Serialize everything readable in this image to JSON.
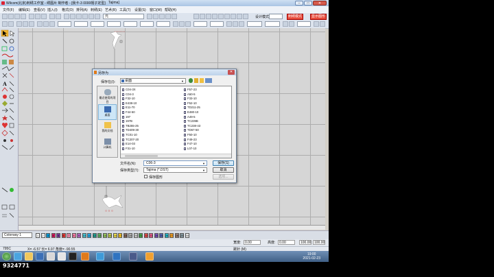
{
  "window": {
    "title": "Wilcom(北京)刺绣工作室 - 绣图片 制作者 - [我卡-3 0000帽子定型]",
    "tab": "Tajima]"
  },
  "menu": [
    "文件(F)",
    "编辑(E)",
    "查看(V)",
    "插入(I)",
    "格式(O)",
    "排列(A)",
    "刺绣(E)",
    "艺术(R)",
    "工具(T)",
    "设置(S)",
    "窗口(W)",
    "帮助(H)"
  ],
  "toolbar": {
    "zoom_value": "元",
    "design_mode_label": "设计模式:",
    "btn_a": "刺绣模式",
    "btn_b": "显示图形"
  },
  "dialog": {
    "title": "另存为",
    "look_in_label": "保存在(I):",
    "look_in_value": "桌面",
    "places": [
      "最近使用的项目",
      "桌面",
      "我的文档",
      "计算机"
    ],
    "files_col1": [
      "C04-3X",
      "C04-3",
      "F32-10",
      "E438-10",
      "E11-70",
      "F44-50",
      "197",
      "197B",
      "TB255-25",
      "TD409-30",
      "TC01-10",
      "TC207-20",
      "E14-03",
      "F31-10"
    ],
    "files_col2": [
      "F57-23",
      "A50-5",
      "F33-10",
      "F52-10",
      "TD211-25",
      "E480-10",
      "A49-5",
      "TC239B",
      "TC238-43",
      "TD67-50",
      "F50-10",
      "F49-23",
      "F47-10",
      "L07-10"
    ],
    "filename_label": "文件名(N):",
    "filename_value": "C06-3",
    "filetype_label": "保存类型(T):",
    "filetype_value": "Tajima (*.DST)",
    "save_btn": "保存(S)",
    "cancel_btn": "取消",
    "options_btn": "选项...",
    "checkbox_label": "保存图形"
  },
  "colorbar": {
    "colorway": "Colorway 1",
    "swatches": [
      {
        "n": "1",
        "c": "#ffffff"
      },
      {
        "n": "2",
        "c": "#ffffff"
      },
      {
        "n": "3",
        "c": "#00a0e0"
      },
      {
        "n": "4",
        "c": "#d81b60"
      },
      {
        "n": "5",
        "c": "#7b3fa0"
      },
      {
        "n": "6",
        "c": "#e53935"
      },
      {
        "n": "7",
        "c": "#f48fb1"
      },
      {
        "n": "8",
        "c": "#ff80ab"
      },
      {
        "n": "9",
        "c": "#ba68c8"
      },
      {
        "n": "10",
        "c": "#4dd0e1"
      },
      {
        "n": "11",
        "c": "#29b6f6"
      },
      {
        "n": "12",
        "c": "#26a69a"
      },
      {
        "n": "13",
        "c": "#66bb6a"
      },
      {
        "n": "14",
        "c": "#9ccc65"
      },
      {
        "n": "15",
        "c": "#d4e157"
      },
      {
        "n": "16",
        "c": "#ffee58"
      },
      {
        "n": "17",
        "c": "#ffca28"
      },
      {
        "n": "18",
        "c": "#8d6e63"
      },
      {
        "n": "19",
        "c": "#bdbdbd"
      },
      {
        "n": "20",
        "c": "#e0e0e0"
      },
      {
        "n": "21",
        "c": "#4caf50"
      },
      {
        "n": "22",
        "c": "#ef5350"
      },
      {
        "n": "23",
        "c": "#f06292"
      },
      {
        "n": "24",
        "c": "#7e57c2"
      },
      {
        "n": "25",
        "c": "#5c6bc0"
      },
      {
        "n": "26",
        "c": "#26c6da"
      },
      {
        "n": "27",
        "c": "#ffa726"
      },
      {
        "n": "28",
        "c": "#a1887f"
      },
      {
        "n": "29",
        "c": "#90a4ae"
      },
      {
        "n": "30",
        "c": "#ffffff"
      }
    ]
  },
  "props": {
    "w_label": "宽度:",
    "w_value": "0.00",
    "h_label": "高度:",
    "h_value": "0.00",
    "pct1": "100.00",
    "pct2": "100.00"
  },
  "status": {
    "left": "795C",
    "coords": "X=  -6.57  长=  6.97  角度=  -90.55",
    "right": "跳针 (M)"
  },
  "taskbar": {
    "time": "19:00",
    "date": "2021-02-23"
  },
  "watermark": "9324771",
  "colors": {
    "accent_red": "#e74a3a",
    "canvas": "#d6d6d6",
    "taskbar": "#3f5f86"
  }
}
